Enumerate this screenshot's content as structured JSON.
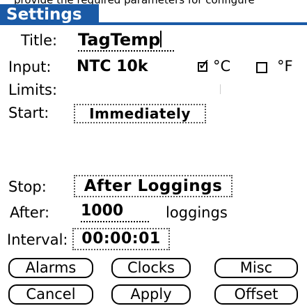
{
  "top_partial_text": "provide the required parameters for configure",
  "window": {
    "title": "Settings",
    "accent_color": "#1a5aa6"
  },
  "fields": {
    "title_label": "Title:",
    "title_value": "TagTemp",
    "input_label": "Input:",
    "input_value": "NTC 10k",
    "celsius_checked": true,
    "celsius_unit": "°C",
    "fahrenheit_checked": false,
    "fahrenheit_unit": "°F",
    "limits_label": "Limits:",
    "start_label": "Start:",
    "start_value": "Immediately",
    "stop_label": "Stop:",
    "stop_value": "After Loggings",
    "after_label": "After:",
    "after_value": "1000",
    "after_unit": "loggings",
    "interval_label": "Interval:",
    "interval_value": "00:00:01"
  },
  "buttons": {
    "alarms": "Alarms",
    "clocks": "Clocks",
    "misc": "Misc",
    "cancel": "Cancel",
    "apply": "Apply",
    "offset": "Offset"
  }
}
